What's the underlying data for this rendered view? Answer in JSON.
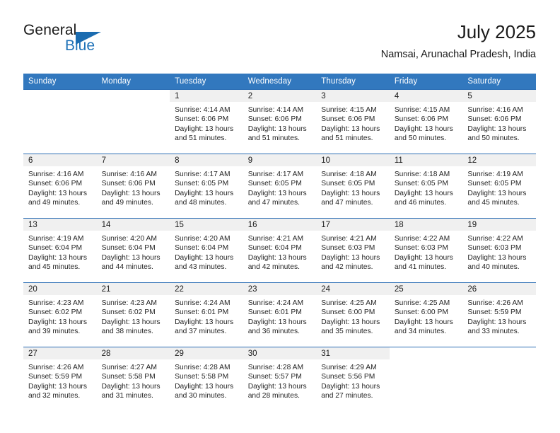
{
  "brand": {
    "name_part1": "General",
    "name_part2": "Blue",
    "accent_color": "#1b6cb0"
  },
  "header": {
    "title": "July 2025",
    "subtitle": "Namsai, Arunachal Pradesh, India"
  },
  "calendar": {
    "header_bg": "#3278be",
    "row_divider_color": "#2d6fb5",
    "daynum_band_bg": "#f0f0f0",
    "weekday_headers": [
      "Sunday",
      "Monday",
      "Tuesday",
      "Wednesday",
      "Thursday",
      "Friday",
      "Saturday"
    ],
    "weeks": [
      [
        {
          "day": "",
          "sunrise": "",
          "sunset": "",
          "daylight_line1": "",
          "daylight_line2": ""
        },
        {
          "day": "",
          "sunrise": "",
          "sunset": "",
          "daylight_line1": "",
          "daylight_line2": ""
        },
        {
          "day": "1",
          "sunrise": "Sunrise: 4:14 AM",
          "sunset": "Sunset: 6:06 PM",
          "daylight_line1": "Daylight: 13 hours",
          "daylight_line2": "and 51 minutes."
        },
        {
          "day": "2",
          "sunrise": "Sunrise: 4:14 AM",
          "sunset": "Sunset: 6:06 PM",
          "daylight_line1": "Daylight: 13 hours",
          "daylight_line2": "and 51 minutes."
        },
        {
          "day": "3",
          "sunrise": "Sunrise: 4:15 AM",
          "sunset": "Sunset: 6:06 PM",
          "daylight_line1": "Daylight: 13 hours",
          "daylight_line2": "and 51 minutes."
        },
        {
          "day": "4",
          "sunrise": "Sunrise: 4:15 AM",
          "sunset": "Sunset: 6:06 PM",
          "daylight_line1": "Daylight: 13 hours",
          "daylight_line2": "and 50 minutes."
        },
        {
          "day": "5",
          "sunrise": "Sunrise: 4:16 AM",
          "sunset": "Sunset: 6:06 PM",
          "daylight_line1": "Daylight: 13 hours",
          "daylight_line2": "and 50 minutes."
        }
      ],
      [
        {
          "day": "6",
          "sunrise": "Sunrise: 4:16 AM",
          "sunset": "Sunset: 6:06 PM",
          "daylight_line1": "Daylight: 13 hours",
          "daylight_line2": "and 49 minutes."
        },
        {
          "day": "7",
          "sunrise": "Sunrise: 4:16 AM",
          "sunset": "Sunset: 6:06 PM",
          "daylight_line1": "Daylight: 13 hours",
          "daylight_line2": "and 49 minutes."
        },
        {
          "day": "8",
          "sunrise": "Sunrise: 4:17 AM",
          "sunset": "Sunset: 6:05 PM",
          "daylight_line1": "Daylight: 13 hours",
          "daylight_line2": "and 48 minutes."
        },
        {
          "day": "9",
          "sunrise": "Sunrise: 4:17 AM",
          "sunset": "Sunset: 6:05 PM",
          "daylight_line1": "Daylight: 13 hours",
          "daylight_line2": "and 47 minutes."
        },
        {
          "day": "10",
          "sunrise": "Sunrise: 4:18 AM",
          "sunset": "Sunset: 6:05 PM",
          "daylight_line1": "Daylight: 13 hours",
          "daylight_line2": "and 47 minutes."
        },
        {
          "day": "11",
          "sunrise": "Sunrise: 4:18 AM",
          "sunset": "Sunset: 6:05 PM",
          "daylight_line1": "Daylight: 13 hours",
          "daylight_line2": "and 46 minutes."
        },
        {
          "day": "12",
          "sunrise": "Sunrise: 4:19 AM",
          "sunset": "Sunset: 6:05 PM",
          "daylight_line1": "Daylight: 13 hours",
          "daylight_line2": "and 45 minutes."
        }
      ],
      [
        {
          "day": "13",
          "sunrise": "Sunrise: 4:19 AM",
          "sunset": "Sunset: 6:04 PM",
          "daylight_line1": "Daylight: 13 hours",
          "daylight_line2": "and 45 minutes."
        },
        {
          "day": "14",
          "sunrise": "Sunrise: 4:20 AM",
          "sunset": "Sunset: 6:04 PM",
          "daylight_line1": "Daylight: 13 hours",
          "daylight_line2": "and 44 minutes."
        },
        {
          "day": "15",
          "sunrise": "Sunrise: 4:20 AM",
          "sunset": "Sunset: 6:04 PM",
          "daylight_line1": "Daylight: 13 hours",
          "daylight_line2": "and 43 minutes."
        },
        {
          "day": "16",
          "sunrise": "Sunrise: 4:21 AM",
          "sunset": "Sunset: 6:04 PM",
          "daylight_line1": "Daylight: 13 hours",
          "daylight_line2": "and 42 minutes."
        },
        {
          "day": "17",
          "sunrise": "Sunrise: 4:21 AM",
          "sunset": "Sunset: 6:03 PM",
          "daylight_line1": "Daylight: 13 hours",
          "daylight_line2": "and 42 minutes."
        },
        {
          "day": "18",
          "sunrise": "Sunrise: 4:22 AM",
          "sunset": "Sunset: 6:03 PM",
          "daylight_line1": "Daylight: 13 hours",
          "daylight_line2": "and 41 minutes."
        },
        {
          "day": "19",
          "sunrise": "Sunrise: 4:22 AM",
          "sunset": "Sunset: 6:03 PM",
          "daylight_line1": "Daylight: 13 hours",
          "daylight_line2": "and 40 minutes."
        }
      ],
      [
        {
          "day": "20",
          "sunrise": "Sunrise: 4:23 AM",
          "sunset": "Sunset: 6:02 PM",
          "daylight_line1": "Daylight: 13 hours",
          "daylight_line2": "and 39 minutes."
        },
        {
          "day": "21",
          "sunrise": "Sunrise: 4:23 AM",
          "sunset": "Sunset: 6:02 PM",
          "daylight_line1": "Daylight: 13 hours",
          "daylight_line2": "and 38 minutes."
        },
        {
          "day": "22",
          "sunrise": "Sunrise: 4:24 AM",
          "sunset": "Sunset: 6:01 PM",
          "daylight_line1": "Daylight: 13 hours",
          "daylight_line2": "and 37 minutes."
        },
        {
          "day": "23",
          "sunrise": "Sunrise: 4:24 AM",
          "sunset": "Sunset: 6:01 PM",
          "daylight_line1": "Daylight: 13 hours",
          "daylight_line2": "and 36 minutes."
        },
        {
          "day": "24",
          "sunrise": "Sunrise: 4:25 AM",
          "sunset": "Sunset: 6:00 PM",
          "daylight_line1": "Daylight: 13 hours",
          "daylight_line2": "and 35 minutes."
        },
        {
          "day": "25",
          "sunrise": "Sunrise: 4:25 AM",
          "sunset": "Sunset: 6:00 PM",
          "daylight_line1": "Daylight: 13 hours",
          "daylight_line2": "and 34 minutes."
        },
        {
          "day": "26",
          "sunrise": "Sunrise: 4:26 AM",
          "sunset": "Sunset: 5:59 PM",
          "daylight_line1": "Daylight: 13 hours",
          "daylight_line2": "and 33 minutes."
        }
      ],
      [
        {
          "day": "27",
          "sunrise": "Sunrise: 4:26 AM",
          "sunset": "Sunset: 5:59 PM",
          "daylight_line1": "Daylight: 13 hours",
          "daylight_line2": "and 32 minutes."
        },
        {
          "day": "28",
          "sunrise": "Sunrise: 4:27 AM",
          "sunset": "Sunset: 5:58 PM",
          "daylight_line1": "Daylight: 13 hours",
          "daylight_line2": "and 31 minutes."
        },
        {
          "day": "29",
          "sunrise": "Sunrise: 4:28 AM",
          "sunset": "Sunset: 5:58 PM",
          "daylight_line1": "Daylight: 13 hours",
          "daylight_line2": "and 30 minutes."
        },
        {
          "day": "30",
          "sunrise": "Sunrise: 4:28 AM",
          "sunset": "Sunset: 5:57 PM",
          "daylight_line1": "Daylight: 13 hours",
          "daylight_line2": "and 28 minutes."
        },
        {
          "day": "31",
          "sunrise": "Sunrise: 4:29 AM",
          "sunset": "Sunset: 5:56 PM",
          "daylight_line1": "Daylight: 13 hours",
          "daylight_line2": "and 27 minutes."
        },
        {
          "day": "",
          "sunrise": "",
          "sunset": "",
          "daylight_line1": "",
          "daylight_line2": ""
        },
        {
          "day": "",
          "sunrise": "",
          "sunset": "",
          "daylight_line1": "",
          "daylight_line2": ""
        }
      ]
    ]
  }
}
